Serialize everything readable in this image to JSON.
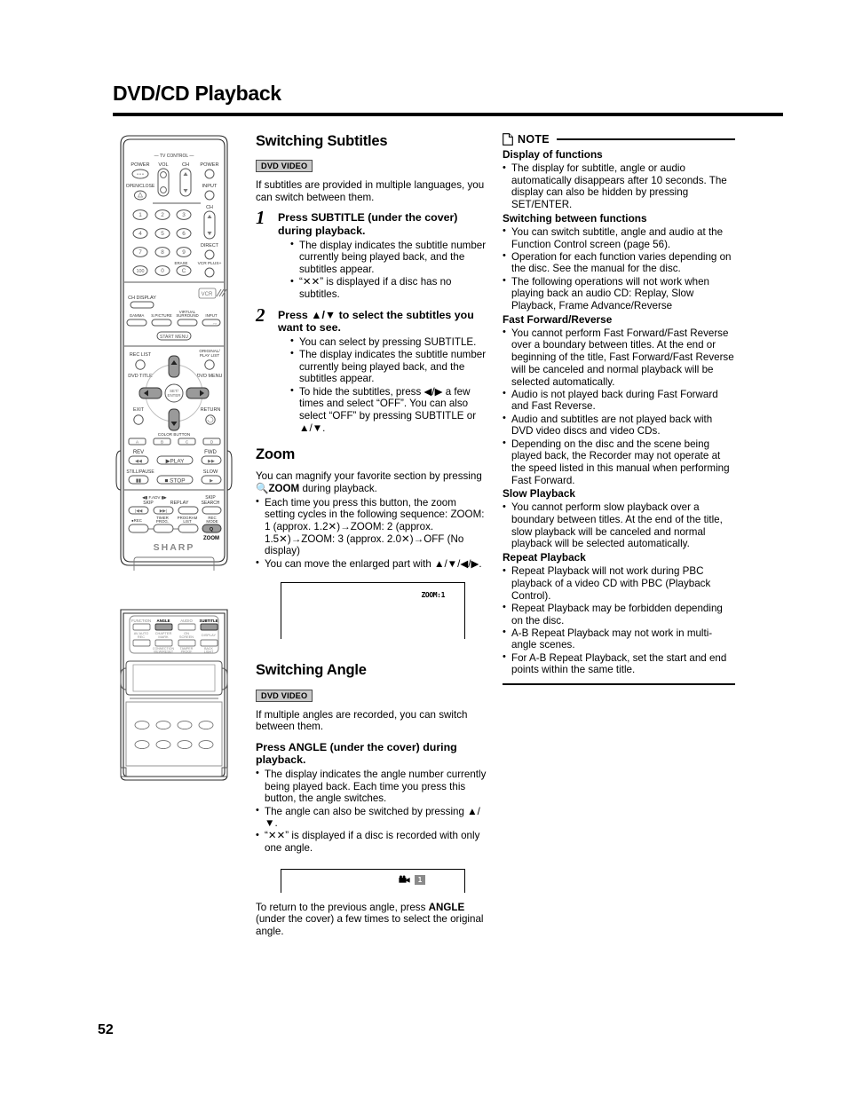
{
  "page": {
    "title": "DVD/CD Playback",
    "folio": "52"
  },
  "sections": {
    "subtitles": {
      "heading": "Switching Subtitles",
      "badge": "DVD VIDEO",
      "intro": "If subtitles are provided in multiple languages, you can switch between them.",
      "steps": [
        {
          "num": "1",
          "head_plain": "Press SUBTITLE (under the cover) during playback.",
          "head_pre": "Press ",
          "head_bold": "SUBTITLE",
          "head_post": " (under the cover) during playback.",
          "bullets": [
            "The display indicates the subtitle number currently being played back, and the subtitles appear.",
            "“✕✕” is displayed if a disc has no subtitles."
          ]
        },
        {
          "num": "2",
          "head_plain": "Press ▲/▼ to select the subtitles you want to see.",
          "head_pre": "Press ",
          "head_bold": "▲/▼",
          "head_post": " to select the subtitles you want to see.",
          "bullets": [
            "You can select by pressing SUBTITLE.",
            "The display indicates the subtitle number currently being played back, and the subtitles appear.",
            "To hide the subtitles, press ◀/▶ a few times and select “OFF”. You can also select “OFF” by pressing SUBTITLE or ▲/▼."
          ]
        }
      ]
    },
    "zoom": {
      "heading": "Zoom",
      "intro_pre": "You can magnify your favorite section by pressing ",
      "intro_bold": "ZOOM",
      "intro_post": " during playback.",
      "bullets": [
        "Each time you press this button, the zoom setting cycles in the following sequence: ZOOM: 1 (approx. 1.2✕)→ZOOM: 2 (approx. 1.5✕)→ZOOM: 3 (approx. 2.0✕)→OFF (No display)",
        "You can move the enlarged part with ▲/▼/◀/▶."
      ],
      "osd": "ZOOM:1"
    },
    "angle": {
      "heading": "Switching Angle",
      "badge": "DVD VIDEO",
      "intro": "If multiple angles are recorded, you can switch between them.",
      "head_pre": "Press ",
      "head_bold": "ANGLE",
      "head_post": " (under the cover) during playback.",
      "bullets": [
        "The display indicates the angle number currently being played back. Each time you press this button, the angle switches.",
        "The angle can also be switched by pressing ▲/▼.",
        "“✕✕” is displayed if a disc is recorded with only one angle."
      ],
      "osd_number": "1",
      "closing_pre": "To return to the previous angle, press ",
      "closing_bold": "ANGLE",
      "closing_post": " (under the cover) a few times to select the original angle."
    }
  },
  "note": {
    "label": "NOTE",
    "groups": [
      {
        "title": "Display of functions",
        "bullets": [
          "The display for subtitle, angle or audio automatically disappears after 10 seconds. The display can also be hidden by pressing SET/ENTER."
        ]
      },
      {
        "title": "Switching between functions",
        "bullets": [
          "You can switch subtitle, angle and audio at the Function Control screen (page 56).",
          "Operation for each function varies depending on the disc. See the manual for the disc.",
          "The following operations will not work when playing back an audio CD: Replay, Slow Playback, Frame Advance/Reverse"
        ]
      },
      {
        "title": "Fast Forward/Reverse",
        "bullets": [
          "You cannot perform Fast Forward/Fast Reverse over a boundary between titles. At the end or beginning of the title, Fast Forward/Fast Reverse will be canceled and normal playback will be selected automatically.",
          "Audio is not played back during Fast Forward and Fast Reverse.",
          "Audio and subtitles are not played back with DVD video discs and video CDs.",
          "Depending on the disc and the scene being played back, the Recorder may not operate at the speed listed in this manual when performing Fast Forward."
        ]
      },
      {
        "title": "Slow Playback",
        "bullets": [
          "You cannot perform slow playback over a boundary between titles. At the end of the title, slow playback will be canceled and normal playback will be selected automatically."
        ]
      },
      {
        "title": "Repeat Playback",
        "bullets": [
          "Repeat Playback will not work during PBC playback of a video CD with PBC (Playback Control).",
          "Repeat Playback may be forbidden depending on the disc.",
          "A-B Repeat Playback may not work in multi-angle scenes.",
          "For A-B Repeat Playback, set the start and end points within the same title."
        ]
      }
    ]
  },
  "remote_top": {
    "tv_control_label": "— TV CONTROL —",
    "labels": [
      "POWER",
      "VOL",
      "CH",
      "POWER",
      "OPEN/CLOSE",
      "INPUT",
      "CH",
      "DIRECT",
      "ERASE",
      "VCR PLUS+",
      "CH DISPLAY",
      "GAMMA",
      "S.PICTURE",
      "VIRTUAL SURROUND",
      "INPUT",
      "START MENU",
      "REC LIST",
      "ORIGINAL/PLAY LIST",
      "DVD TITLE",
      "DVD MENU",
      "SET/ENTER",
      "EXIT",
      "RETURN",
      "COLOR BUTTON",
      "A",
      "B",
      "C",
      "D",
      "REV",
      "FWD",
      "PLAY",
      "STILL/PAUSE",
      "SLOW",
      "STOP",
      "F.ADV",
      "SKIP",
      "REPLAY",
      "SKIP SEARCH",
      "REC",
      "TIMER PROG.",
      "PROGRAM LIST",
      "REC MODE",
      "ZOOM"
    ],
    "keypad": [
      "1",
      "2",
      "3",
      "4",
      "5",
      "6",
      "7",
      "8",
      "9",
      "100",
      "0",
      "C"
    ],
    "brand": "SHARP",
    "vcr_badge": "VCR"
  },
  "remote_bottom": {
    "row1": [
      "FUNCTION",
      "ANGLE",
      "AUDIO",
      "SUBTITLE"
    ],
    "row2": [
      "AV AUTO REC",
      "CHAPTER MARK",
      "ON SCREEN",
      "DISPLAY"
    ],
    "row3": [
      "CONNECTION VIEW/RESET",
      "TAMPER PROOF",
      "BACK LIGHT"
    ],
    "highlighted": [
      "ANGLE",
      "SUBTITLE"
    ]
  }
}
